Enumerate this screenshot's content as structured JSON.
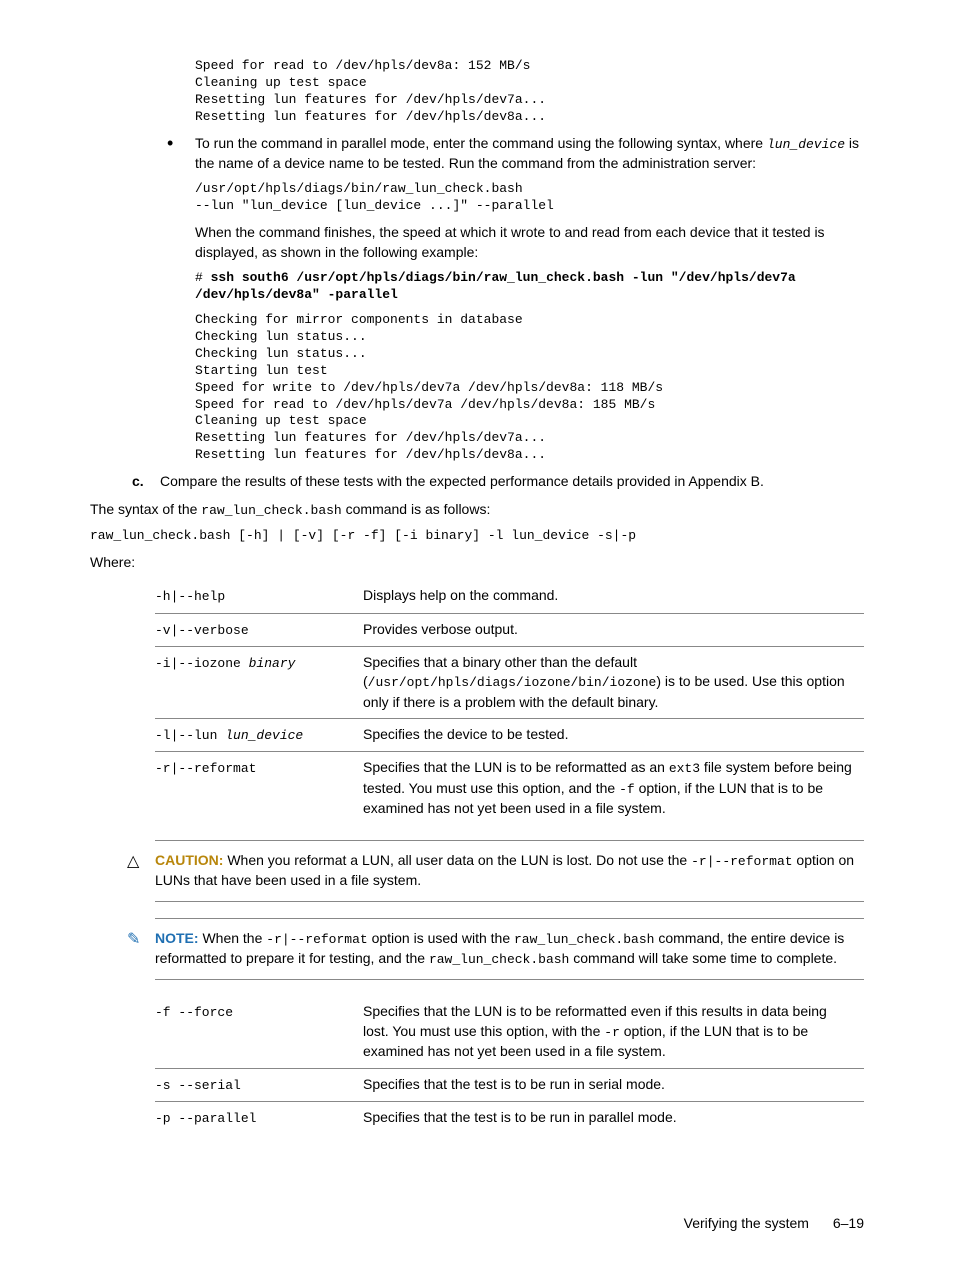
{
  "preamble_output": "Speed for read to /dev/hpls/dev8a: 152 MB/s\nCleaning up test space\nResetting lun features for /dev/hpls/dev7a...\nResetting lun features for /dev/hpls/dev8a...",
  "bullet_intro_1": "To run the command in parallel mode, enter the command using the following syntax, where ",
  "bullet_intro_code": "lun_device",
  "bullet_intro_2": " is the name of a device name to be tested. Run the command from the administration server:",
  "parallel_cmd": "/usr/opt/hpls/diags/bin/raw_lun_check.bash\n--lun \"lun_device [lun_device ...]\" --parallel",
  "parallel_after": "When the command finishes, the speed at which it wrote to and read from each device that it tested is displayed, as shown in the following example:",
  "parallel_example_prefix": "# ",
  "parallel_example_bold": "ssh south6 /usr/opt/hpls/diags/bin/raw_lun_check.bash -lun \"/dev/hpls/dev7a /dev/hpls/dev8a\" -parallel",
  "parallel_output": "Checking for mirror components in database\nChecking lun status...\nChecking lun status...\nStarting lun test\nSpeed for write to /dev/hpls/dev7a /dev/hpls/dev8a: 118 MB/s\nSpeed for read to /dev/hpls/dev7a /dev/hpls/dev8a: 185 MB/s\nCleaning up test space\nResetting lun features for /dev/hpls/dev7a...\nResetting lun features for /dev/hpls/dev8a...",
  "step_c_label": "c.",
  "step_c_text": "Compare the results of these tests with the expected performance details provided in Appendix B.",
  "syntax_intro_1": "The syntax of the ",
  "syntax_intro_code": "raw_lun_check.bash",
  "syntax_intro_2": " command is as follows:",
  "syntax_line": "raw_lun_check.bash [-h] | [-v] [-r -f] [-i binary] -l lun_device -s|-p",
  "where_label": "Where:",
  "options1": [
    {
      "flag": "-h|--help",
      "flag_arg": "",
      "desc": "Displays help on the command."
    },
    {
      "flag": "-v|--verbose",
      "flag_arg": "",
      "desc": "Provides verbose output."
    },
    {
      "flag": "-i|--iozone ",
      "flag_arg": "binary",
      "desc_1": "Specifies that a binary other than the default (",
      "desc_code1": "/usr/opt/hpls/diags/iozone/bin/iozone",
      "desc_2": ") is to be used. Use this option only if there is a problem with the default binary."
    },
    {
      "flag": "-l|--lun ",
      "flag_arg": "lun_device",
      "desc": "Specifies the device to be tested."
    },
    {
      "flag": "-r|--reformat",
      "flag_arg": "",
      "desc_1": "Specifies that the LUN is to be reformatted as an ",
      "desc_code1": "ext3",
      "desc_2": " file system before being tested. You must use this option, and the ",
      "desc_code2": "-f",
      "desc_3": " option, if the LUN that is to be examined has not yet been used in a file system."
    }
  ],
  "caution": {
    "title": "CAUTION:",
    "text_1": "  When you reformat a LUN, all user data on the LUN is lost. Do not use the ",
    "code": "-r|--reformat",
    "text_2": " option on LUNs that have been used in a file system."
  },
  "note": {
    "title": "NOTE:",
    "text_1": "  When the ",
    "code1": "-r|--reformat",
    "text_2": " option is used with the ",
    "code2": "raw_lun_check.bash",
    "text_3": " command, the entire device is reformatted to prepare it for testing, and the ",
    "code3": "raw_lun_check.bash",
    "text_4": " command will take some time to complete."
  },
  "options2": [
    {
      "flag": "-f --force",
      "desc_1": "Specifies that the LUN is to be reformatted even if this results in data being lost. You must use this option, with the ",
      "desc_code1": "-r",
      "desc_2": " option, if the LUN that is to be examined has not yet been used in a file system."
    },
    {
      "flag": "-s --serial",
      "desc": "Specifies that the test is to be run in serial mode."
    },
    {
      "flag": "-p --parallel",
      "desc": "Specifies that the test is to be run in parallel mode."
    }
  ],
  "footer_text": "Verifying the system",
  "page_number": "6–19"
}
